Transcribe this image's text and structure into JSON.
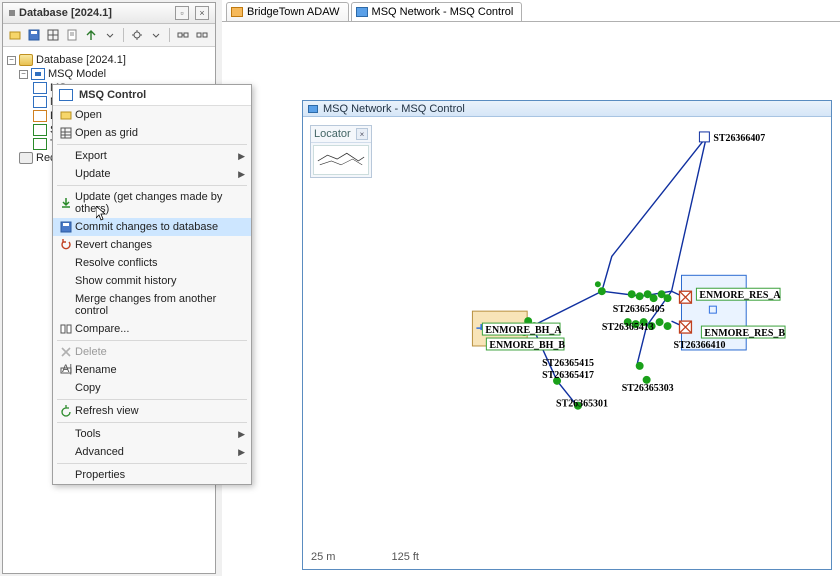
{
  "panel": {
    "title": "Database [2024.1]",
    "tree": {
      "root": "Database [2024.1]",
      "model": "MSQ Model",
      "children": [
        "MS",
        "MS",
        "Den",
        "Sol",
        "The"
      ],
      "recycle": "Recycle B"
    }
  },
  "context_menu": {
    "header": "MSQ Control",
    "items": [
      {
        "label": "Open",
        "icon": "open-icon"
      },
      {
        "label": "Open as grid",
        "icon": "grid-icon"
      },
      {
        "sep": true
      },
      {
        "label": "Export",
        "submenu": true
      },
      {
        "label": "Update",
        "submenu": true
      },
      {
        "sep": true
      },
      {
        "label": "Update (get changes made by others)",
        "icon": "pull-icon"
      },
      {
        "label": "Commit changes to database",
        "icon": "commit-icon",
        "hover": true
      },
      {
        "label": "Revert changes",
        "icon": "revert-icon"
      },
      {
        "label": "Resolve conflicts"
      },
      {
        "label": "Show commit history"
      },
      {
        "label": "Merge changes from another control"
      },
      {
        "label": "Compare...",
        "icon": "compare-icon"
      },
      {
        "sep": true
      },
      {
        "label": "Delete",
        "icon": "delete-icon",
        "disabled": true
      },
      {
        "label": "Rename",
        "icon": "rename-icon"
      },
      {
        "label": "Copy"
      },
      {
        "sep": true
      },
      {
        "label": "Refresh view",
        "icon": "refresh-icon"
      },
      {
        "sep": true
      },
      {
        "label": "Tools",
        "submenu": true
      },
      {
        "label": "Advanced",
        "submenu": true
      },
      {
        "sep": true
      },
      {
        "label": "Properties"
      }
    ]
  },
  "tabs": [
    {
      "label": "BridgeTown ADAW",
      "icon": "orange"
    },
    {
      "label": "MSQ Network - MSQ Control",
      "icon": "blue",
      "active": true
    }
  ],
  "canvas": {
    "title": "MSQ Network - MSQ Control",
    "locator": {
      "title": "Locator",
      "close": "×"
    },
    "scale": {
      "left": "25 m",
      "right": "125 ft"
    },
    "labels": {
      "top_pipe": "ST26366407",
      "enmore_res_a": "ENMORE_RES_A",
      "enmore_res_b": "ENMORE_RES_B",
      "cluster_top": "ST26365405",
      "cluster_left": "ST26365413",
      "cluster_right": "ST26366410",
      "bh_a": "ENMORE_BH_A",
      "bh_b": "ENMORE_BH_B",
      "mid1": "ST26365415",
      "mid2": "ST26365417",
      "bot1": "ST26365303",
      "bot2": "ST26365301"
    }
  }
}
